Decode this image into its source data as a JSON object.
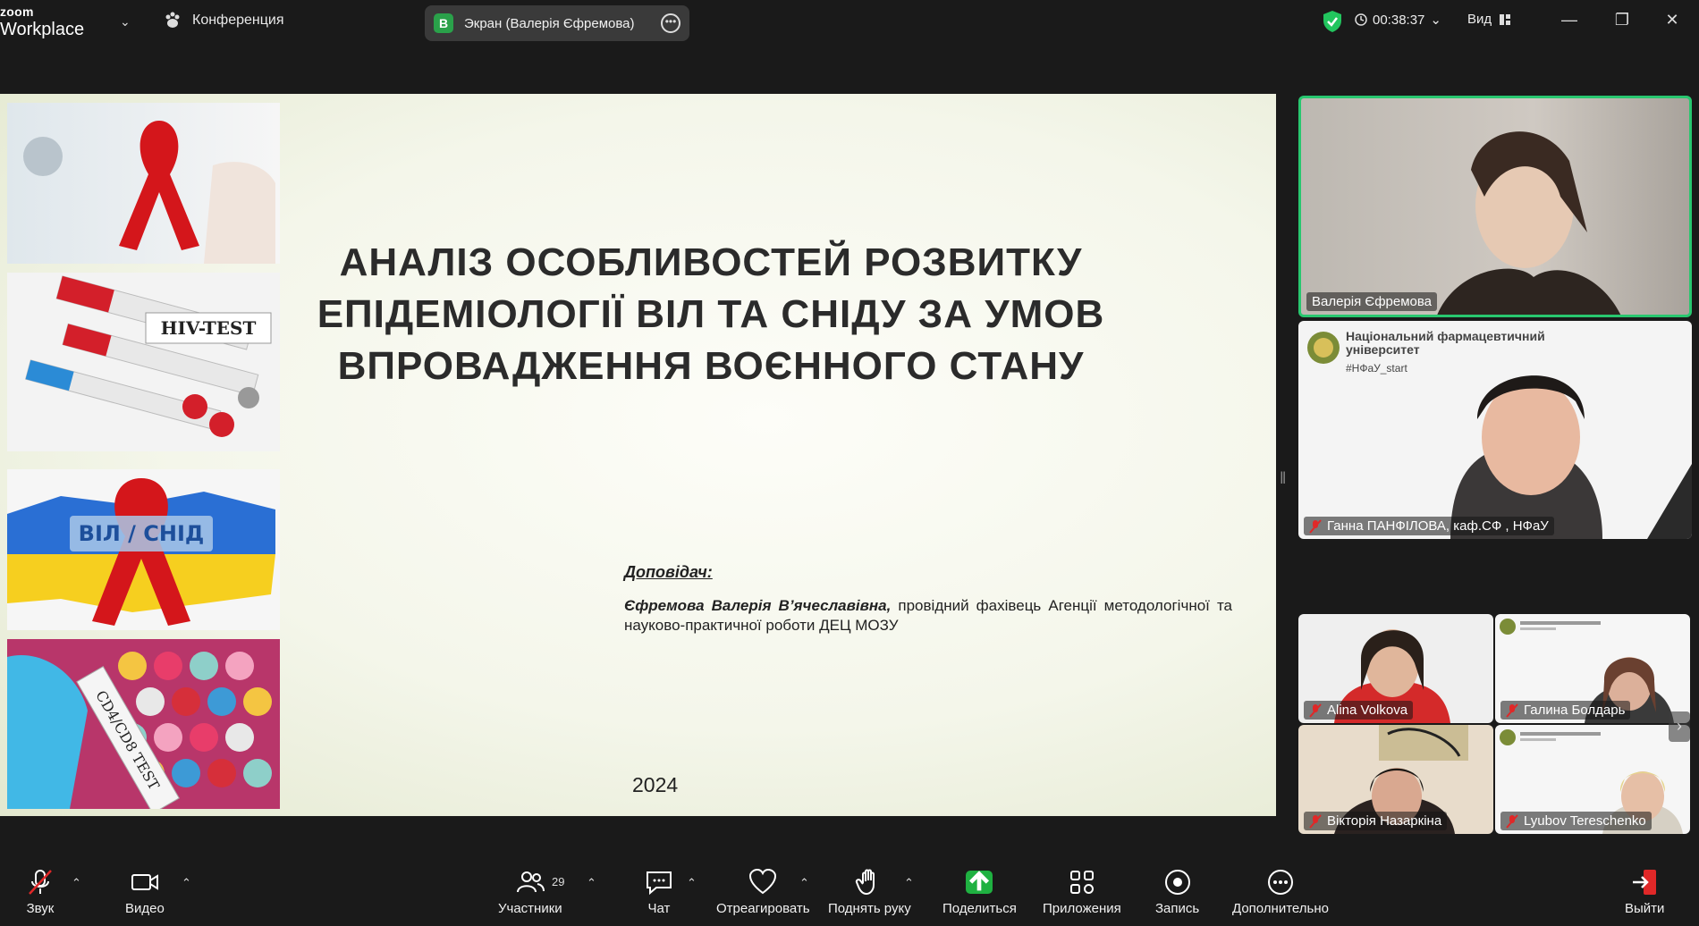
{
  "app": {
    "logo_small": "zoom",
    "logo_large": "Workplace"
  },
  "titlebar": {
    "conference_label": "Конференция",
    "share_pill": {
      "badge": "В",
      "label": "Экран (Валерія Єфремова)"
    },
    "timer": "00:38:37",
    "view_label": "Вид"
  },
  "slide": {
    "title": "АНАЛІЗ ОСОБЛИВОСТЕЙ РОЗВИТКУ ЕПІДЕМІОЛОГІЇ ВІЛ ТА СНІДУ ЗА УМОВ ВПРОВАДЖЕННЯ ВОЄННОГО СТАНУ",
    "reporter_label": "Доповідач:",
    "reporter_name": "Єфремова Валерія В’ячеславівна,",
    "reporter_desc": " провідний фахівець Агенції методологічної та науково-практичної роботи ДЕЦ МОЗУ",
    "year": "2024",
    "image_labels": {
      "hiv_test": "HIV-TEST",
      "vil_snid": "ВІЛ / СНІД",
      "cd_test": "CD4/CD8 TEST"
    }
  },
  "participants": {
    "main": [
      {
        "name": "Валерія Єфремова",
        "muted": false
      },
      {
        "name": "Ганна ПАНФІЛОВА, каф.СФ , НФаУ",
        "muted": true,
        "logo_line1": "Національний фармацевтичний",
        "logo_line2": "університет",
        "logo_tag": "#НФаУ_start"
      }
    ],
    "grid": [
      {
        "name": "Alina Volkova",
        "muted": true
      },
      {
        "name": "Галина Болдарь",
        "muted": true
      },
      {
        "name": "Вікторія Назаркіна",
        "muted": true
      },
      {
        "name": "Lyubov Tereschenko",
        "muted": true
      }
    ]
  },
  "toolbar": {
    "audio": "Звук",
    "video": "Видео",
    "participants": "Участники",
    "participants_count": "29",
    "chat": "Чат",
    "react": "Отреагировать",
    "raise_hand": "Поднять руку",
    "share": "Поделиться",
    "apps": "Приложения",
    "record": "Запись",
    "more": "Дополнительно",
    "leave": "Выйти"
  },
  "colors": {
    "share_green": "#1fb141",
    "active_speaker": "#28c76f",
    "shield_green": "#22c55e"
  }
}
